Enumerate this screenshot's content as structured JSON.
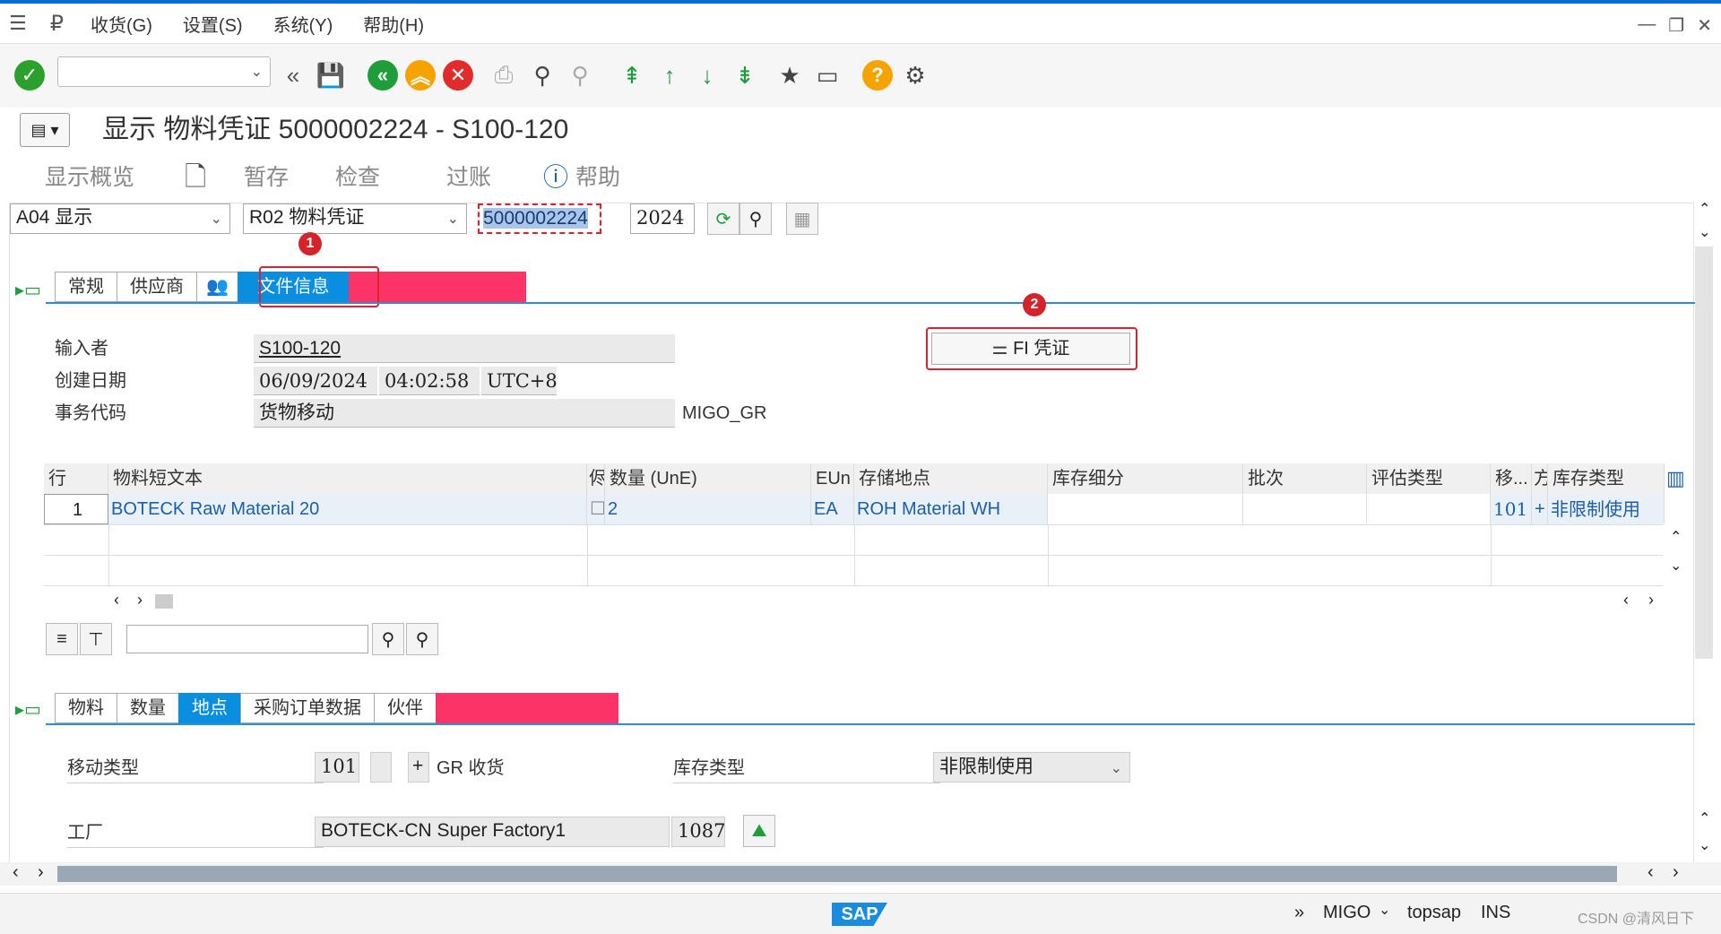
{
  "menu": {
    "items": [
      "收货(G)",
      "设置(S)",
      "系统(Y)",
      "帮助(H)"
    ]
  },
  "toolbar": {
    "command_value": "",
    "help_glyph": "?"
  },
  "title": "显示 物料凭证 5000002224 - S100-120",
  "app_toolbar": {
    "overview": "显示概览",
    "hold": "暂存",
    "check": "检查",
    "post": "过账",
    "help": "帮助"
  },
  "header": {
    "action": "A04 显示",
    "reference": "R02 物料凭证",
    "doc_number": "5000002224",
    "year": "2024"
  },
  "header_tabs": [
    "常规",
    "供应商",
    "文件信息"
  ],
  "fi_button": "FI 凭证",
  "doc_info": {
    "entered_by_label": "输入者",
    "entered_by": "S100-120",
    "created_label": "创建日期",
    "created_date": "06/09/2024",
    "created_time": "04:02:58",
    "timezone": "UTC+8",
    "tcode_label": "事务代码",
    "tcode_desc": "货物移动",
    "tcode": "MIGO_GR"
  },
  "table": {
    "headers": [
      "行",
      "物料短文本",
      "侭",
      "数量 (UnE)",
      "EUn",
      "存储地点",
      "库存细分",
      "批次",
      "评估类型",
      "移...",
      "方",
      "库存类型"
    ],
    "row": {
      "line": "1",
      "material": "BOTECK Raw Material 20",
      "qty": "2",
      "unit": "EA",
      "sloc": "ROH Material WH",
      "mvt": "101",
      "sign": "+",
      "stock_type": "非限制使用"
    }
  },
  "item_tabs": [
    "物料",
    "数量",
    "地点",
    "采购订单数据",
    "伙伴"
  ],
  "item_detail": {
    "mvt_label": "移动类型",
    "mvt": "101",
    "sign": "+",
    "mvt_desc": "GR 收货",
    "stock_type_label": "库存类型",
    "stock_type": "非限制使用",
    "plant_label": "工厂",
    "plant_name": "BOTECK-CN Super Factory1",
    "plant": "1087"
  },
  "status_bar": {
    "tcode": "MIGO",
    "server": "topsap",
    "mode": "INS",
    "watermark": "CSDN @清风日下",
    "logo": "SAP"
  },
  "colors": {
    "accent": "#0a8ee0",
    "mask": "#fc3366",
    "highlight_red": "#e0202e"
  }
}
